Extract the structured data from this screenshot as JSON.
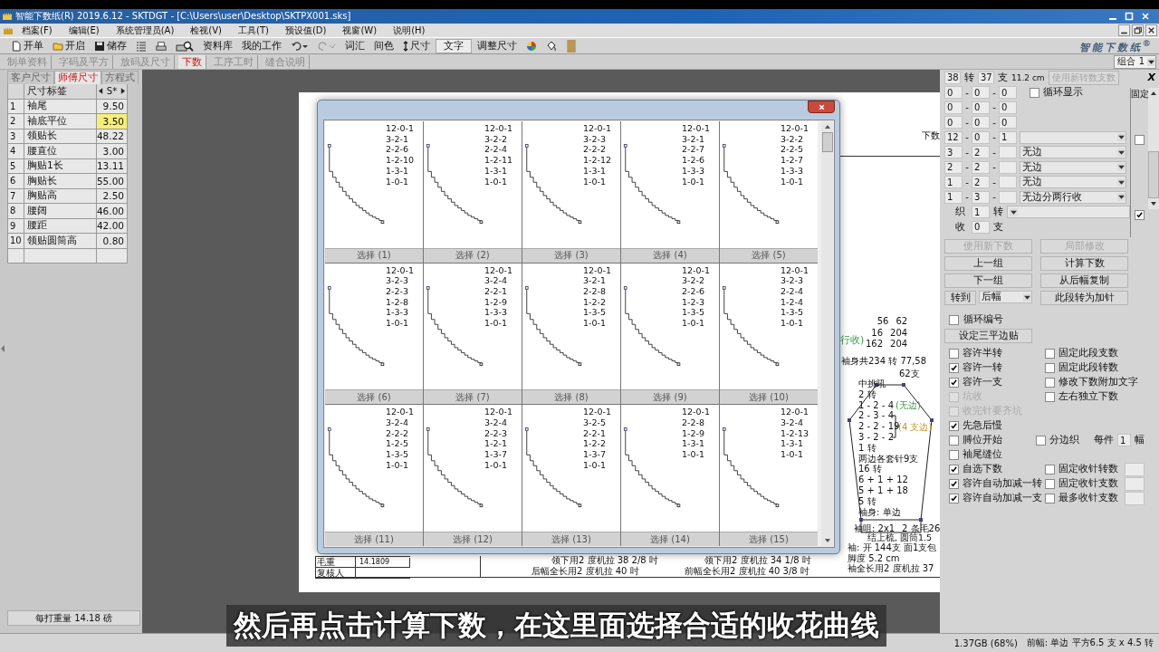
{
  "title_bar": {
    "title": "智能下数纸(R) 2019.6.12 - SKTDGT - [C:\\Users\\user\\Desktop\\SKTPX001.sks]"
  },
  "menu": [
    "档案(F)",
    "编辑(E)",
    "系统管理员(A)",
    "检视(V)",
    "工具(T)",
    "预设值(D)",
    "视窗(W)",
    "说明(H)"
  ],
  "toolbar": [
    {
      "label": "开单",
      "pressed": false
    },
    {
      "label": "开启",
      "pressed": false
    },
    {
      "label": "储存",
      "pressed": false
    },
    {
      "pressed": false
    },
    {
      "pressed": false
    },
    {
      "pressed": false
    },
    {
      "label": "资料库",
      "pressed": false
    },
    {
      "label": "我的工作",
      "pressed": false
    },
    {
      "pressed": false
    },
    {
      "pressed": false
    },
    {
      "label": "词汇",
      "pressed": false
    },
    {
      "label": "间色",
      "pressed": false
    },
    {
      "label": "尺寸",
      "pressed": false
    },
    {
      "label": "文字",
      "pressed": true
    },
    {
      "label": "调整尺寸",
      "pressed": false
    },
    {
      "pressed": false
    },
    {
      "pressed": false
    },
    {
      "pressed": false
    }
  ],
  "logo": "智能下数纸$^{®}$",
  "doc_tabs": [
    {
      "label": "制单资料",
      "selected": false
    },
    {
      "label": "字码及平方",
      "selected": false
    },
    {
      "label": "放码及尺寸",
      "selected": false
    },
    {
      "label": "下数",
      "selected": true
    },
    {
      "label": "工序工时",
      "selected": false
    },
    {
      "label": "缝合说明",
      "selected": false
    }
  ],
  "combo": "组合 1",
  "left_panel": {
    "tabs": [
      {
        "label": "客户尺寸",
        "selected": false
      },
      {
        "label": "师傅尺寸",
        "selected": true
      },
      {
        "label": "方程式",
        "selected": false
      }
    ],
    "header": {
      "label": "尺寸标签",
      "size": "S*"
    },
    "rows": [
      {
        "no": "1",
        "name": "袖尾",
        "value": "9.50",
        "selected": false
      },
      {
        "no": "2",
        "name": "袖底平位",
        "value": "3.50",
        "selected": true
      },
      {
        "no": "3",
        "name": "领贴长",
        "value": "48.22",
        "selected": false
      },
      {
        "no": "4",
        "name": "腰直位",
        "value": "3.00",
        "selected": false
      },
      {
        "no": "5",
        "name": "胸贴1长",
        "value": "13.11",
        "selected": false
      },
      {
        "no": "6",
        "name": "胸贴长",
        "value": "55.00",
        "selected": false
      },
      {
        "no": "7",
        "name": "胸贴高",
        "value": "2.50",
        "selected": false
      },
      {
        "no": "8",
        "name": "腰阔",
        "value": "46.00",
        "selected": false
      },
      {
        "no": "9",
        "name": "腰距",
        "value": "42.00",
        "selected": false
      },
      {
        "no": "10",
        "name": "领贴圆筒高",
        "value": "0.80",
        "selected": false
      }
    ],
    "footer": "每打重量 14.18 磅"
  },
  "paper": {
    "corner_label": "下数",
    "note_tail": "行收)",
    "counts": [
      [
        "56",
        "62"
      ],
      [
        "16",
        "204"
      ],
      [
        "162",
        "204"
      ]
    ],
    "body_total": "袖身共234 转 77,58",
    "body_count": "62支",
    "sleeve_lines": [
      {
        "text": "中挑吼"
      },
      {
        "text": "2 转"
      },
      {
        "text": "1 - 2 - 4",
        "note": "(无边)"
      },
      {
        "text": "2 - 3 - 4"
      },
      {
        "text": "2 - 2 - 19"
      },
      {
        "text": "3 - 2 - 2"
      },
      {
        "text": "1 转"
      },
      {
        "text": "两边各套针9支"
      },
      {
        "text": "16 转"
      },
      {
        "text": "6 + 1 + 12"
      },
      {
        "text": "5 + 1 + 18"
      },
      {
        "text": "5 转"
      },
      {
        "text": "袖身: 单边"
      }
    ],
    "side_note": "(4 支边)",
    "cuff": "袖咀: 2x1",
    "cuff_2": "2 条毛26",
    "cuff_3": "结上梳, 圆筒1.5",
    "lower_lines": [
      "袖: 开 144支 面1支包",
      "脚度 5.2 cm",
      "袖全长用2 度机拉 37"
    ],
    "form": [
      {
        "label": "毛重",
        "value": "14.1809"
      },
      {
        "label": "复核人"
      }
    ],
    "notes": [
      "领下用2 度机拉 38 2/8 吋",
      "领下用2 度机拉 34 1/8 吋",
      "后幅全长用2 度机拉 40 吋",
      "前幅全长用2 度机拉 40 3/8 吋"
    ]
  },
  "dialog": {
    "cells": [
      {
        "lines": [
          "12-0-1",
          "3-2-1",
          "2-2-6",
          "1-2-10",
          "1-3-1",
          "1-0-1"
        ],
        "button": "选择 (1)"
      },
      {
        "lines": [
          "12-0-1",
          "3-2-2",
          "2-2-4",
          "1-2-11",
          "1-3-1",
          "1-0-1"
        ],
        "button": "选择 (2)"
      },
      {
        "lines": [
          "12-0-1",
          "3-2-3",
          "2-2-2",
          "1-2-12",
          "1-3-1",
          "1-0-1"
        ],
        "button": "选择 (3)"
      },
      {
        "lines": [
          "12-0-1",
          "3-2-1",
          "2-2-7",
          "1-2-6",
          "1-3-3",
          "1-0-1"
        ],
        "button": "选择 (4)"
      },
      {
        "lines": [
          "12-0-1",
          "3-2-2",
          "2-2-5",
          "1-2-7",
          "1-3-3",
          "1-0-1"
        ],
        "button": "选择 (5)"
      },
      {
        "lines": [
          "12-0-1",
          "3-2-3",
          "2-2-3",
          "1-2-8",
          "1-3-3",
          "1-0-1"
        ],
        "button": "选择 (6)"
      },
      {
        "lines": [
          "12-0-1",
          "3-2-4",
          "2-2-1",
          "1-2-9",
          "1-3-3",
          "1-0-1"
        ],
        "button": "选择 (7)"
      },
      {
        "lines": [
          "12-0-1",
          "3-2-1",
          "2-2-8",
          "1-2-2",
          "1-3-5",
          "1-0-1"
        ],
        "button": "选择 (8)"
      },
      {
        "lines": [
          "12-0-1",
          "3-2-2",
          "2-2-6",
          "1-2-3",
          "1-3-5",
          "1-0-1"
        ],
        "button": "选择 (9)"
      },
      {
        "lines": [
          "12-0-1",
          "3-2-3",
          "2-2-4",
          "1-2-4",
          "1-3-5",
          "1-0-1"
        ],
        "button": "选择 (10)"
      },
      {
        "lines": [
          "12-0-1",
          "3-2-4",
          "2-2-2",
          "1-2-5",
          "1-3-5",
          "1-0-1"
        ],
        "button": "选择 (11)"
      },
      {
        "lines": [
          "12-0-1",
          "3-2-4",
          "2-2-3",
          "1-2-1",
          "1-3-7",
          "1-0-1"
        ],
        "button": "选择 (12)"
      },
      {
        "lines": [
          "12-0-1",
          "3-2-5",
          "2-2-1",
          "1-2-2",
          "1-3-7",
          "1-0-1"
        ],
        "button": "选择 (13)"
      },
      {
        "lines": [
          "12-0-1",
          "2-2-8",
          "1-2-9",
          "1-3-1",
          "1-0-1"
        ],
        "button": "选择 (14)"
      },
      {
        "lines": [
          "12-0-1",
          "3-2-4",
          "1-2-13",
          "1-3-1",
          "1-0-1"
        ],
        "button": "选择 (15)"
      }
    ]
  },
  "right_panel": {
    "turns": "38",
    "turns_unit": "转",
    "needles": "37",
    "needles_unit": "支",
    "length": "11.2 cm",
    "apply_button": {
      "label": "使用新转数支数",
      "disabled": true
    },
    "close": "X",
    "loop_display": {
      "label": "循环显示",
      "checked": false
    },
    "fixed_label": "固定",
    "separator": "-",
    "steps": [
      {
        "a": "0",
        "b": "0",
        "c": "0",
        "kind": "plain"
      },
      {
        "a": "0",
        "b": "0",
        "c": "0",
        "kind": "plain"
      },
      {
        "a": "0",
        "b": "0",
        "c": "0",
        "kind": "plain"
      },
      {
        "a": "12",
        "b": "0",
        "c": "1",
        "kind": "select",
        "fixed": false
      },
      {
        "a": "3",
        "b": "2",
        "kind": "select",
        "option": "无边"
      },
      {
        "a": "2",
        "b": "2",
        "kind": "select",
        "option": "无边"
      },
      {
        "a": "1",
        "b": "2",
        "kind": "select",
        "option": "无边"
      },
      {
        "a": "1",
        "b": "3",
        "kind": "select",
        "option": "无边分两行收"
      }
    ],
    "knit": {
      "label": "织",
      "value": "1",
      "unit": "转",
      "fixed": true
    },
    "bind": {
      "label": "收",
      "value": "0",
      "unit": "支"
    },
    "buttons": [
      {
        "label": "使用新下数",
        "disabled": true
      },
      {
        "label": "局部修改",
        "disabled": true
      },
      {
        "label": "上一组",
        "disabled": false
      },
      {
        "label": "计算下数",
        "disabled": false
      },
      {
        "label": "下一组",
        "disabled": false
      },
      {
        "label": "从后幅复制",
        "disabled": false
      }
    ],
    "goto": {
      "label": "转到",
      "option": "后幅"
    },
    "convert_button": "此段转为加针",
    "loop_number": {
      "label": "循环编号",
      "checked": false
    },
    "three_flat_button": "设定三平边贴",
    "options": [
      {
        "left": {
          "label": "容许半转",
          "checked": false,
          "disabled": false
        },
        "right": {
          "label": "固定此段支数",
          "checked": false,
          "kind": "plain"
        }
      },
      {
        "left": {
          "label": "容许一转",
          "checked": true,
          "disabled": false
        },
        "right": {
          "label": "固定此段转数",
          "checked": false,
          "kind": "plain"
        }
      },
      {
        "left": {
          "label": "容许一支",
          "checked": true,
          "disabled": false
        },
        "right": {
          "label": "修改下数附加文字",
          "checked": false,
          "kind": "plain"
        }
      },
      {
        "left": {
          "label": "坑收",
          "checked": false,
          "disabled": true
        },
        "right": {
          "label": "左右独立下数",
          "checked": false,
          "kind": "plain"
        }
      },
      {
        "left": {
          "label": "收完针要齐坑",
          "checked": false,
          "disabled": true
        }
      },
      {
        "left": {
          "label": "先急后慢",
          "checked": true,
          "disabled": false
        }
      },
      {
        "left": {
          "label": "膊位开始",
          "checked": false,
          "disabled": false
        },
        "right": {
          "label": "分边织",
          "checked": false,
          "kind": "pieces",
          "prefix": "每件",
          "value": "1",
          "suffix": "幅"
        }
      },
      {
        "left": {
          "label": "袖尾缝位",
          "checked": false,
          "disabled": false
        }
      },
      {
        "left": {
          "label": "自选下数",
          "checked": true,
          "disabled": false
        },
        "right": {
          "label": "固定收针转数",
          "checked": false,
          "kind": "field"
        }
      },
      {
        "left": {
          "label": "容许自动加减一转",
          "checked": true,
          "disabled": false
        },
        "right": {
          "label": "固定收针支数",
          "checked": false,
          "kind": "field"
        }
      },
      {
        "left": {
          "label": "容许自动加减一支",
          "checked": true,
          "disabled": false
        },
        "right": {
          "label": "最多收针支数",
          "checked": false,
          "kind": "field"
        }
      }
    ]
  },
  "caption": "然后再点击计算下数，在这里面选择合适的收花曲线",
  "status_bar": [
    "1.37GB (68%)",
    "前幅: 单边 平方6.5 支 x 4.5 转"
  ]
}
